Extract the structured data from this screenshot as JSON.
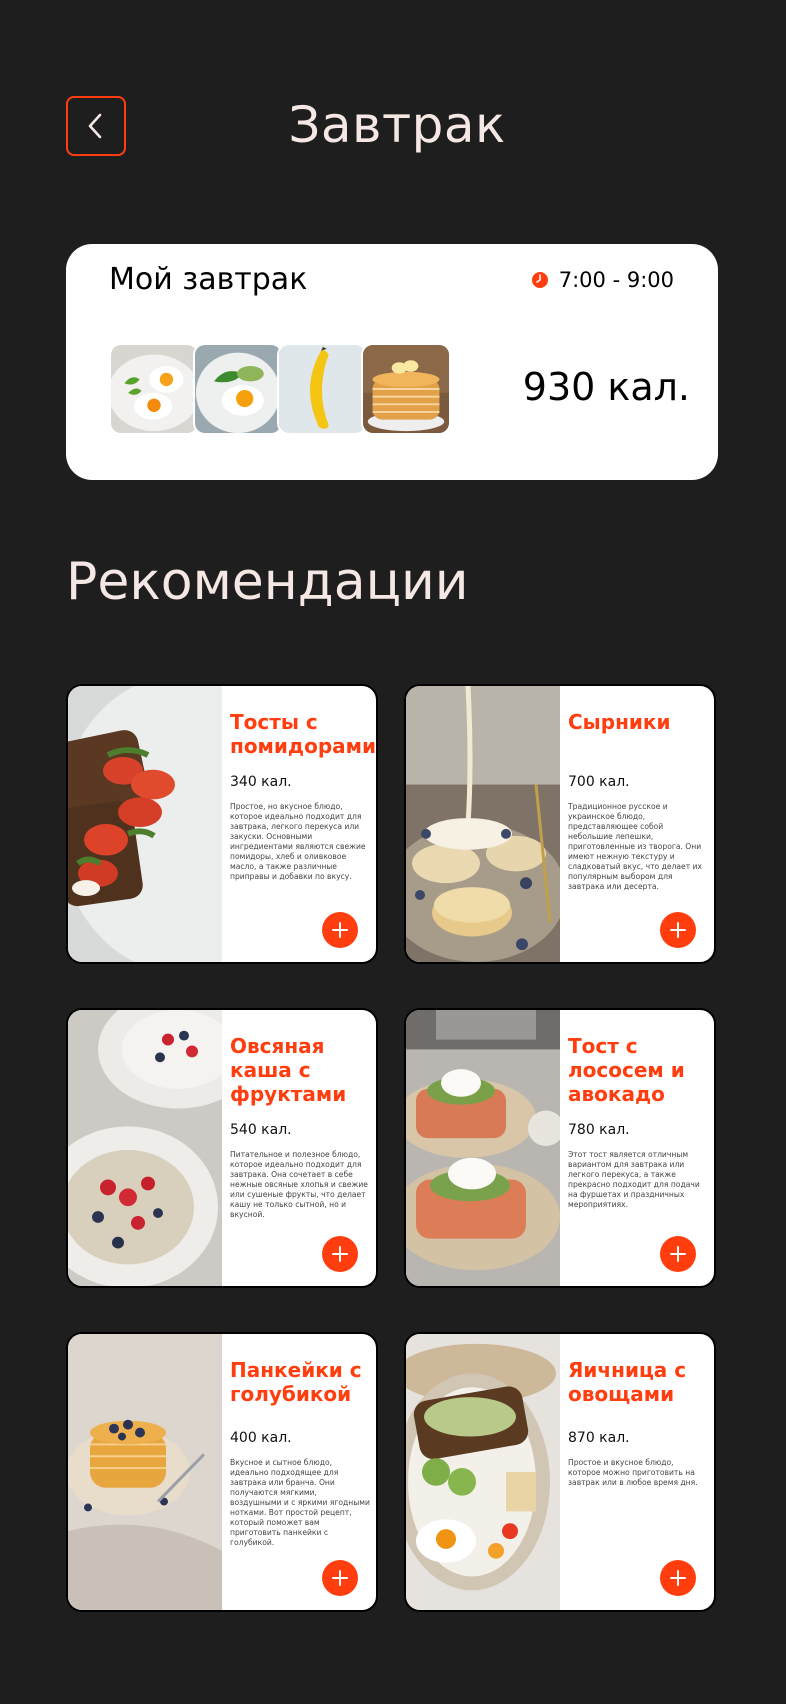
{
  "header": {
    "title": "Завтрак",
    "back_icon": "chevron-left-icon",
    "accent": "#ff3d0e"
  },
  "my_breakfast": {
    "title": "Мой завтрак",
    "time": "7:00 - 9:00",
    "clock_icon": "clock-icon",
    "calories": "930 кал.",
    "thumbs": [
      "fried-eggs-arugula",
      "eggs-avocado-toast",
      "banana",
      "pancake-stack"
    ]
  },
  "recommendations": {
    "title": "Рекомендации",
    "items": [
      {
        "title": "Тосты с помидорами",
        "calories": "340 кал.",
        "description": "Простое, но вкусное блюдо, которое идеально подходит для завтрака, легкого перекуса или закуски. Основными ингредиентами являются свежие помидоры, хлеб и оливковое масло, а также различные приправы и добавки по вкусу.",
        "image": "tomato-toast-photo"
      },
      {
        "title": "Сырники",
        "calories": "700 кал.",
        "description": "Традиционное русское и украинское блюдо, представляющее собой небольшие лепешки, приготовленные из творога. Они имеют нежную текстуру и сладковатый вкус, что делает их популярным выбором для завтрака или десерта.",
        "image": "syrniki-photo"
      },
      {
        "title": "Овсяная каша с фруктами",
        "calories": "540 кал.",
        "description": "Питательное и полезное блюдо, которое идеально подходит для завтрака. Она сочетает в себе нежные овсяные хлопья и свежие или сушеные фрукты, что делает кашу не только сытной, но и вкусной.",
        "image": "oatmeal-berries-photo"
      },
      {
        "title": "Тост с лососем и авокадо",
        "calories": "780 кал.",
        "description": "Этот тост является отличным вариантом для завтрака или легкого перекуса, а также прекрасно подходит для подачи на фуршетах и праздничных мероприятиях.",
        "image": "salmon-avocado-toast-photo"
      },
      {
        "title": "Панкейки с голубикой",
        "calories": "400 кал.",
        "description": "Вкусное и сытное блюдо, идеально подходящее для завтрака или бранча. Они получаются мягкими, воздушными и с яркими ягодными нотками. Вот простой рецепт, который поможет вам приготовить панкейки с голубикой.",
        "image": "blueberry-pancakes-photo"
      },
      {
        "title": "Яичница с овощами",
        "calories": "870 кал.",
        "description": "Простое и вкусное блюдо, которое можно приготовить на завтрак или в любое время дня.",
        "image": "eggs-vegetables-photo"
      }
    ]
  }
}
